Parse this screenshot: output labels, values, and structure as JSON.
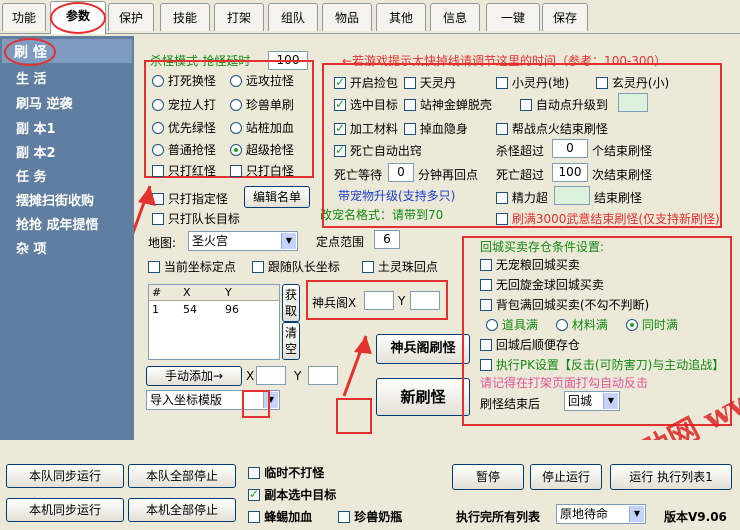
{
  "tabs": [
    "功能",
    "参数",
    "保护",
    "技能",
    "打架",
    "组队",
    "物品",
    "其他",
    "信息",
    "一键",
    "保存"
  ],
  "nav": [
    "刷 怪",
    "生 活",
    "刷马 逆袭",
    "副 本1",
    "副 本2",
    "任 务",
    "摆摊扫街收购",
    "抢抢 成年提悟",
    "杂 项"
  ],
  "kill_mode": {
    "title": "杀怪模式-抢怪延时",
    "delay": "100",
    "options": [
      "打死换怪",
      "远攻拉怪",
      "宠拉人打",
      "珍兽单刷",
      "优先绿怪",
      "站桩加血",
      "普通抢怪",
      "超级抢怪"
    ],
    "only_red": "只打红怪",
    "only_white": "只打白怪",
    "only_spec": "只打指定怪",
    "edit_list": "编辑名单",
    "only_team": "只打队长目标"
  },
  "hint_top": "←若游戏提示太快掉线请调节这里的时间（参考：100-300）",
  "right_opts": {
    "open_pick": "开启捡包",
    "tianling": "天灵丹",
    "xiaoling": "小灵丹(地)",
    "xuanling": "玄灵丹(小)",
    "select_target": "选中目标",
    "zhanshen": "站神金蝉脱壳",
    "auto_upgrade": "自动点升级到",
    "process_mat": "加工材料",
    "drop_blood": "掉血隐身",
    "gang_fire": "帮战点火结束刷怪",
    "death_auto": "死亡自动出窍",
    "kill_over": "杀怪超过",
    "kill_over_val": "0",
    "kill_over_suffix": "个结束刷怪",
    "death_wait": "死亡等待",
    "death_wait_val": "0",
    "death_wait_suffix": "分钟再回点",
    "death_over": "死亡超过",
    "death_over_val": "100",
    "death_over_suffix": "次结束刷怪",
    "energy_over": "精力超",
    "energy_suffix": "结束刷怪",
    "swords_full": "刷满3000武意结束刷怪(仅支持新刷怪)"
  },
  "pet_upgrade": "带宠物升级(支持多只)",
  "pet_format": "改宠名格式：请带到70",
  "map": {
    "label": "地图:",
    "value": "圣火宫",
    "range_label": "定点范围",
    "range_value": "6"
  },
  "coord_opts": {
    "current": "当前坐标定点",
    "follow": "跟随队长坐标",
    "earth_bead": "土灵珠回点"
  },
  "coord_table": {
    "headers": [
      "#",
      "X",
      "Y"
    ],
    "rows": [
      [
        "1",
        "54",
        "96"
      ]
    ],
    "get": "获取",
    "clear": "清空"
  },
  "manual_add": "手动添加→",
  "x_label": "X",
  "y_label": "Y",
  "import_template": "导入坐标模版",
  "shenbing": {
    "label": "神兵阁X",
    "y": "Y",
    "btn": "神兵阁刷怪"
  },
  "new_refresh": "新刷怪",
  "return_city": {
    "title": "回城买卖存仓条件设置:",
    "no_pet_food": "无宠粮回城买卖",
    "no_xuanfeng": "无回旋金球回城买卖",
    "bag_full": "背包满回城买卖(不勾不判断)",
    "prop_full": "道具满",
    "mat_full": "材料满",
    "both_full": "同时满",
    "after_return": "回城后顺便存仓",
    "pk_setting": "执行PK设置【反击(可防害刀)与主动追战】",
    "pk_hint": "请记得在打架页面打勾自动反击",
    "end_after": "刷怪结束后",
    "end_value": "回城"
  },
  "bottom": {
    "team_sync": "本队同步运行",
    "team_stop": "本队全部停止",
    "local_sync": "本机同步运行",
    "local_stop": "本机全部停止",
    "temp_no_fight": "临时不打怪",
    "copy_target": "副本选中目标",
    "bee_heal": "蜂蜴加血",
    "pet_milk": "珍兽奶瓶",
    "pause": "暂停",
    "stop": "停止运行",
    "run_list": "运行 执行列表1",
    "after_list": "执行完所有列表",
    "after_value": "原地待命",
    "version": "版本V9.06",
    "watermark": "玄武辅助网 www.clbbfz.com"
  }
}
